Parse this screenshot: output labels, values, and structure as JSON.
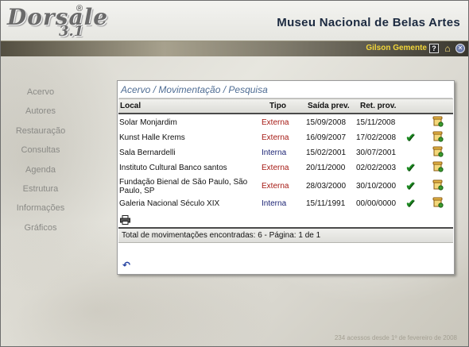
{
  "logo": {
    "word": "Dorsale",
    "version": "3.1",
    "reg": "®"
  },
  "header": {
    "title": "Museu Nacional de Belas Artes"
  },
  "user_bar": {
    "user_name": "Gilson Gemente",
    "help_glyph": "?",
    "home_glyph": "⌂",
    "logout_glyph": "✕",
    "icons": [
      "help-icon",
      "home-icon",
      "logout-icon"
    ],
    "accent": "#f2d63a"
  },
  "sidebar": {
    "items": [
      {
        "label": "Acervo"
      },
      {
        "label": "Autores"
      },
      {
        "label": "Restauração"
      },
      {
        "label": "Consultas"
      },
      {
        "label": "Agenda"
      },
      {
        "label": "Estrutura"
      },
      {
        "label": "Informações"
      },
      {
        "label": "Gráficos"
      }
    ]
  },
  "panel": {
    "title": "Acervo / Movimentação / Pesquisa",
    "columns": {
      "local": "Local",
      "tipo": "Tipo",
      "saida": "Saída prev.",
      "retorno": "Ret. prov."
    },
    "rows": [
      {
        "local": "Solar Monjardim",
        "tipo": "Externa",
        "saida": "15/09/2008",
        "retorno": "15/11/2008",
        "returned": false
      },
      {
        "local": "Kunst Halle Krems",
        "tipo": "Externa",
        "saida": "16/09/2007",
        "retorno": "17/02/2008",
        "returned": true
      },
      {
        "local": "Sala Bernardelli",
        "tipo": "Interna",
        "saida": "15/02/2001",
        "retorno": "30/07/2001",
        "returned": false
      },
      {
        "local": "Instituto Cultural Banco santos",
        "tipo": "Externa",
        "saida": "20/11/2000",
        "retorno": "02/02/2003",
        "returned": true
      },
      {
        "local": "Fundação Bienal de São Paulo, São Paulo, SP",
        "tipo": "Externa",
        "saida": "28/03/2000",
        "retorno": "30/10/2000",
        "returned": true
      },
      {
        "local": "Galeria Nacional Século XIX",
        "tipo": "Interna",
        "saida": "15/11/1991",
        "retorno": "00/00/0000",
        "returned": true
      }
    ],
    "check_glyph": "✔",
    "row_icons": [
      "check-icon",
      "scroll-edit-icon"
    ],
    "footer": "Total de movimentações encontradas: 6 - Página: 1 de 1",
    "back_glyph": "↶",
    "colors": {
      "externa": "#a61a14",
      "interna": "#1c2474",
      "title": "#4f6d94"
    }
  },
  "hits": "234 acessos desde 1º de fevereiro de 2008"
}
